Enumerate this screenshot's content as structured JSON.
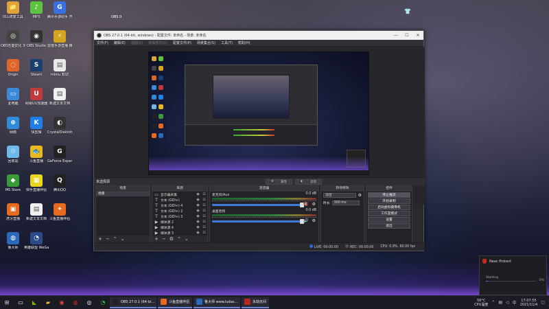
{
  "desktop": {
    "icons": [
      {
        "label": "DLL修复工具",
        "color": "#e0a33a",
        "glyph": "📁"
      },
      {
        "label": "MP3",
        "color": "#5ec43f",
        "glyph": "♪"
      },
      {
        "label": "腾讯手游助手 开放平台",
        "color": "#3a6fe0",
        "glyph": "G"
      },
      {
        "label": "OBS性能优化 3DM整合",
        "color": "#444",
        "glyph": "◎"
      },
      {
        "label": "OBS Studio",
        "color": "#333",
        "glyph": "◉"
      },
      {
        "label": "雷霆手游直播 推流",
        "color": "#d6a41f",
        "glyph": "⚡"
      },
      {
        "label": "Origin",
        "color": "#e0652a",
        "glyph": "◌"
      },
      {
        "label": "Steam",
        "color": "#1a3e6e",
        "glyph": "S"
      },
      {
        "label": "mimu 知识",
        "color": "#e8e8e8",
        "glyph": "▤"
      },
      {
        "label": "此电脑",
        "color": "#3a8ad8",
        "glyph": "▭"
      },
      {
        "label": "网易UU加速器",
        "color": "#c23b3b",
        "glyph": "U"
      },
      {
        "label": "新建文本文档",
        "color": "#f0f0f0",
        "glyph": "▤"
      },
      {
        "label": "网络",
        "color": "#2f8ad8",
        "glyph": "⊕"
      },
      {
        "label": "快剪辑",
        "color": "#1f7fe8",
        "glyph": "K"
      },
      {
        "label": "CrystalDiskInfo",
        "color": "#333",
        "glyph": "◐"
      },
      {
        "label": "回收站",
        "color": "#6fb8e8",
        "glyph": "♲"
      },
      {
        "label": "斗鱼直播",
        "color": "#e8b81f",
        "glyph": "🐟"
      },
      {
        "label": "GeForce Experience",
        "color": "#222",
        "glyph": "G"
      },
      {
        "label": "MS Store",
        "color": "#3a9a3a",
        "glyph": "◆"
      },
      {
        "label": "快手直播伴侣",
        "color": "#e8d81f",
        "glyph": "▦"
      },
      {
        "label": "腾讯QQ",
        "color": "#222",
        "glyph": "Q"
      },
      {
        "label": "虎牙直播",
        "color": "#e86a1f",
        "glyph": "▣"
      },
      {
        "label": "新建文本文档",
        "color": "#f0f0f0",
        "glyph": "▤"
      },
      {
        "label": "斗鱼直播伴侣",
        "color": "#e86a1f",
        "glyph": "✦"
      },
      {
        "label": "鲁大师",
        "color": "#2a6ab8",
        "glyph": "◍"
      },
      {
        "label": "英雄联盟 WeGame",
        "color": "#2a4a88",
        "glyph": "◔"
      }
    ],
    "top_text": "OBS   0",
    "top_right_glyph": "👕"
  },
  "obs": {
    "title": "OBS 27.0.1 (64-bit, windows) - 配置文件: 未命名 - 场景: 未命名",
    "menu": [
      "文件(F)",
      "编辑(E)",
      "视图(V)",
      "停靠部件(D)",
      "配置文件(P)",
      "场景集合(S)",
      "工具(T)",
      "帮助(H)"
    ],
    "scene_header": "未选择源",
    "scene_header_buttons": [
      "属性",
      "滤镜"
    ],
    "docks": {
      "scenes": {
        "title": "场景",
        "items": [
          "场景"
        ]
      },
      "sources": {
        "title": "来源",
        "items": [
          {
            "icon": "display-icon",
            "glyph": "▭",
            "name": "显示器采集"
          },
          {
            "icon": "text-icon",
            "glyph": "T",
            "name": "文本 (GDI+)"
          },
          {
            "icon": "text-icon",
            "glyph": "T",
            "name": "文本 (GDI+) 4"
          },
          {
            "icon": "text-icon",
            "glyph": "T",
            "name": "文本 (GDI+) 2"
          },
          {
            "icon": "text-icon",
            "glyph": "T",
            "name": "文本 (GDI+) 3"
          },
          {
            "icon": "media-icon",
            "glyph": "▶",
            "name": "媒体源 2"
          },
          {
            "icon": "media-icon",
            "glyph": "▶",
            "name": "媒体源 4"
          },
          {
            "icon": "media-icon",
            "glyph": "▶",
            "name": "媒体源 3"
          }
        ]
      },
      "mixer": {
        "title": "混音器",
        "tracks": [
          {
            "name": "麦克风/Aux",
            "db": "0.0 dB",
            "level": 0.0,
            "fader": 0.86
          },
          {
            "name": "桌面音频",
            "db": "0.0 dB",
            "level": 0.0,
            "fader": 0.86
          }
        ]
      },
      "transitions": {
        "title": "转场特效",
        "select": "淡出",
        "duration_label": "时长",
        "duration": "300 ms"
      },
      "controls": {
        "title": "控件",
        "buttons": [
          "停止推流",
          "开始录制",
          "启动虚拟摄像机",
          "工作室模式",
          "设置",
          "退出"
        ]
      }
    },
    "status": {
      "live": "LIVE: 00:00:00",
      "rec": "REC: 00:00:00",
      "cpu": "CPU: 0.9%, 60.00 fps"
    }
  },
  "toast": {
    "title": "Neac Protect",
    "status": "Starting",
    "progress_pct": "0%",
    "progress": 0.04
  },
  "taskbar": {
    "apps": [
      {
        "label": "OBS 27.0.1 (64-bi...",
        "color": "#222"
      },
      {
        "label": "斗鱼直播伴侣",
        "color": "#e86a1f"
      },
      {
        "label": "鲁大师 www.ludas...",
        "color": "#2a6ab8"
      },
      {
        "label": "永劫无间",
        "color": "#b8281f"
      }
    ],
    "weather_temp": "56°C",
    "weather_desc": "CPU温度",
    "time": "17:07:55",
    "date": "2021/11/4"
  }
}
